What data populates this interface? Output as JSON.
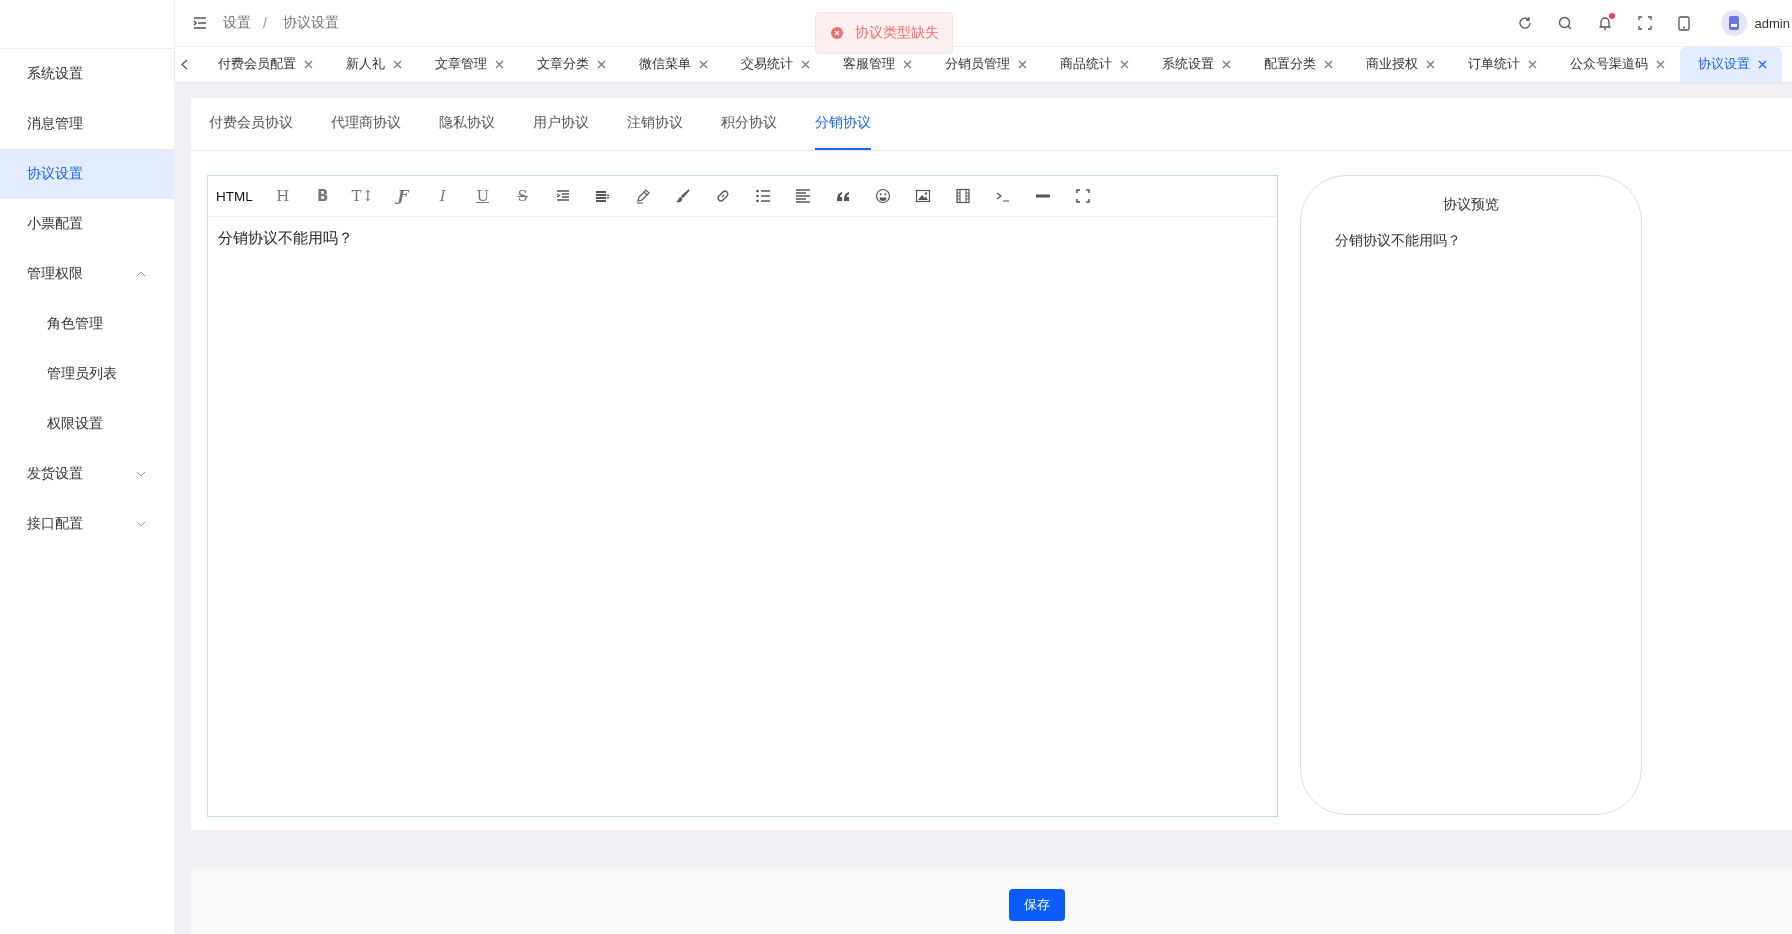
{
  "breadcrumb": [
    "设置",
    "协议设置"
  ],
  "breadcrumb_separator": "/",
  "toast": {
    "kind": "error",
    "message": "协议类型缺失"
  },
  "header": {
    "notification_dot": true,
    "user": "admin"
  },
  "sidebar": {
    "items": [
      {
        "label": "系统设置",
        "selected": false
      },
      {
        "label": "消息管理",
        "selected": false
      },
      {
        "label": "协议设置",
        "selected": true
      },
      {
        "label": "小票配置",
        "selected": false
      },
      {
        "label": "管理权限",
        "selected": false,
        "expanded": true,
        "children": [
          {
            "label": "角色管理",
            "selected": false
          },
          {
            "label": "管理员列表",
            "selected": false
          },
          {
            "label": "权限设置",
            "selected": false
          }
        ]
      },
      {
        "label": "发货设置",
        "selected": false,
        "expanded": false
      },
      {
        "label": "接口配置",
        "selected": false,
        "expanded": false
      }
    ]
  },
  "page_tabs": [
    {
      "label": "付费会员配置",
      "selected": false
    },
    {
      "label": "新人礼",
      "selected": false
    },
    {
      "label": "文章管理",
      "selected": false
    },
    {
      "label": "文章分类",
      "selected": false
    },
    {
      "label": "微信菜单",
      "selected": false
    },
    {
      "label": "交易统计",
      "selected": false
    },
    {
      "label": "客服管理",
      "selected": false
    },
    {
      "label": "分销员管理",
      "selected": false
    },
    {
      "label": "商品统计",
      "selected": false
    },
    {
      "label": "系统设置",
      "selected": false
    },
    {
      "label": "配置分类",
      "selected": false
    },
    {
      "label": "商业授权",
      "selected": false
    },
    {
      "label": "订单统计",
      "selected": false
    },
    {
      "label": "公众号渠道码",
      "selected": false
    },
    {
      "label": "协议设置",
      "selected": true
    }
  ],
  "agreement_tabs": [
    {
      "label": "付费会员协议",
      "selected": false
    },
    {
      "label": "代理商协议",
      "selected": false
    },
    {
      "label": "隐私协议",
      "selected": false
    },
    {
      "label": "用户协议",
      "selected": false
    },
    {
      "label": "注销协议",
      "selected": false
    },
    {
      "label": "积分协议",
      "selected": false
    },
    {
      "label": "分销协议",
      "selected": true
    }
  ],
  "editor": {
    "source_label": "HTML",
    "format_glyphs": [
      "H",
      "B",
      "T↕",
      "Ƒ",
      "I",
      "U",
      "S"
    ],
    "content": "分销协议不能用吗？"
  },
  "preview": {
    "title": "协议预览",
    "content": "分销协议不能用吗？"
  },
  "save_button": "保存"
}
